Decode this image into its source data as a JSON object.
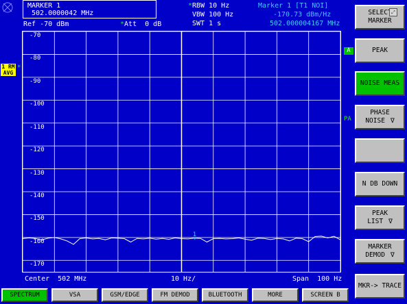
{
  "marker_box": {
    "title": "MARKER 1",
    "freq": "502.0000042 MHz"
  },
  "header": {
    "ref": "Ref -70 dBm",
    "att": "Att  0 dB",
    "rbw": "RBW 10 Hz",
    "vbw": "VBW 100 Hz",
    "swt": "SWT 1 s",
    "marker_info": "Marker 1 [T1 NOI]",
    "marker_level": "-170.73 dBm/Hz",
    "marker_freq": "502.000004167 MHz"
  },
  "side_labels": {
    "trace_mode_1": "1 RM",
    "trace_mode_2": "AVG",
    "a_flag": "A",
    "pa_flag": "PA"
  },
  "plot": {
    "y_ticks": [
      "-70",
      "-80",
      "-90",
      "-100",
      "-110",
      "-120",
      "-130",
      "-140",
      "-150",
      "-160",
      "-170"
    ],
    "center": "Center  502 MHz",
    "div": "10 Hz/",
    "span": "Span  100 Hz",
    "marker_label": "1"
  },
  "softkeys": [
    {
      "line1": "SELECT",
      "line2": "MARKER",
      "active": false
    },
    {
      "line1": "PEAK",
      "line2": "",
      "active": false
    },
    {
      "line1": "NOISE MEAS",
      "line2": "",
      "active": true
    },
    {
      "line1": "PHASE",
      "line2": "NOISE",
      "arrow": true,
      "active": false
    },
    {
      "line1": "",
      "line2": "",
      "active": false
    },
    {
      "line1": "N DB DOWN",
      "line2": "",
      "active": false
    },
    {
      "line1": "PEAK",
      "line2": "LIST",
      "arrow": true,
      "active": false
    },
    {
      "line1": "MARKER",
      "line2": "DEMOD",
      "arrow": true,
      "active": false
    },
    {
      "line1": "MKR-> TRACE",
      "line2": "",
      "active": false
    }
  ],
  "tabs": [
    "SPECTRUM",
    "VSA",
    "GSM/EDGE",
    "FM DEMOD",
    "BLUETOOTH",
    "MORE",
    "SCREEN B"
  ],
  "active_tab": "SPECTRUM",
  "trace": {
    "x_hz": [
      -50,
      -48,
      -46,
      -44,
      -42,
      -40,
      -38,
      -36,
      -34,
      -32,
      -30,
      -28,
      -26,
      -24,
      -22,
      -20,
      -18,
      -16,
      -14,
      -12,
      -10,
      -8,
      -6,
      -4,
      -2,
      0,
      2,
      4,
      6,
      8,
      10,
      12,
      14,
      16,
      18,
      20,
      22,
      24,
      26,
      28,
      30,
      32,
      34,
      36,
      38,
      40,
      42,
      44,
      46,
      48,
      50
    ],
    "level_dbm": [
      -160.5,
      -160.2,
      -160.4,
      -161,
      -160.3,
      -160,
      -160.6,
      -161.5,
      -163,
      -160.5,
      -160.2,
      -160.6,
      -160.4,
      -161,
      -160.2,
      -160.3,
      -160.5,
      -162,
      -160.4,
      -160.6,
      -160.3,
      -160.7,
      -160.4,
      -160.8,
      -160.2,
      -160.5,
      -160.6,
      -160.3,
      -160.4,
      -162,
      -160.5,
      -160.4,
      -160.6,
      -160.5,
      -160.2,
      -160.7,
      -161.2,
      -160.3,
      -160.4,
      -160.9,
      -160.4,
      -160.6,
      -161.5,
      -160.3,
      -160.5,
      -161.8,
      -159.6,
      -159.4,
      -160.2,
      -159.5,
      -161
    ]
  }
}
